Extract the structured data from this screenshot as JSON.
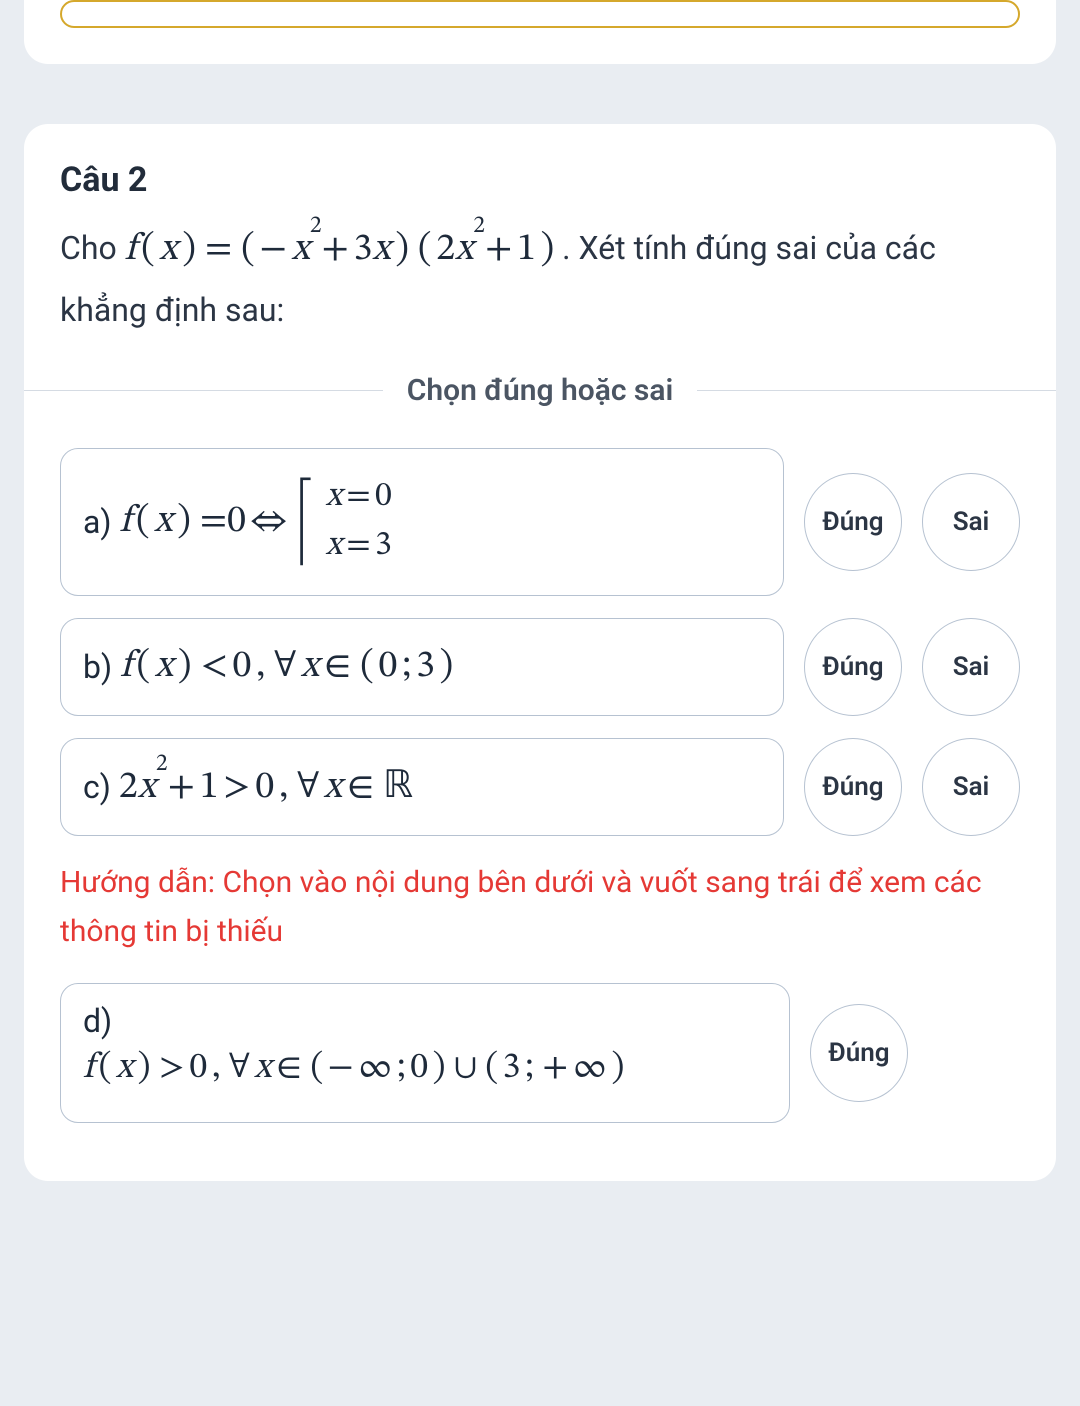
{
  "question": {
    "title": "Câu 2",
    "prefix": "Cho ",
    "formula": "f ( x ) = ( − x² + 3x ) ( 2x² + 1 )",
    "suffix": " . Xét tính đúng sai của các khẳng định sau:"
  },
  "divider_label": "Chọn đúng hoặc sai",
  "true_label": "Đúng",
  "false_label": "Sai",
  "hint": "Hướng dẫn: Chọn vào nội dung bên dưới và vuốt sang trái để xem các thông tin bị thiếu",
  "options": {
    "a": {
      "label": "a)",
      "lhs": "f ( x ) = 0 ⇔",
      "line1": "x = 0",
      "line2": "x = 3"
    },
    "b": {
      "label": "b)",
      "expr": "f ( x ) < 0 , ∀ x ∈ ( 0 ; 3 )"
    },
    "c": {
      "label": "c)",
      "expr": "2x² + 1 > 0 , ∀ x ∈ ℝ"
    },
    "d": {
      "label": "d)",
      "expr": "f ( x ) > 0 , ∀ x ∈ ( − ∞ ; 0 ) ∪ ( 3 ; + ∞ )"
    }
  }
}
